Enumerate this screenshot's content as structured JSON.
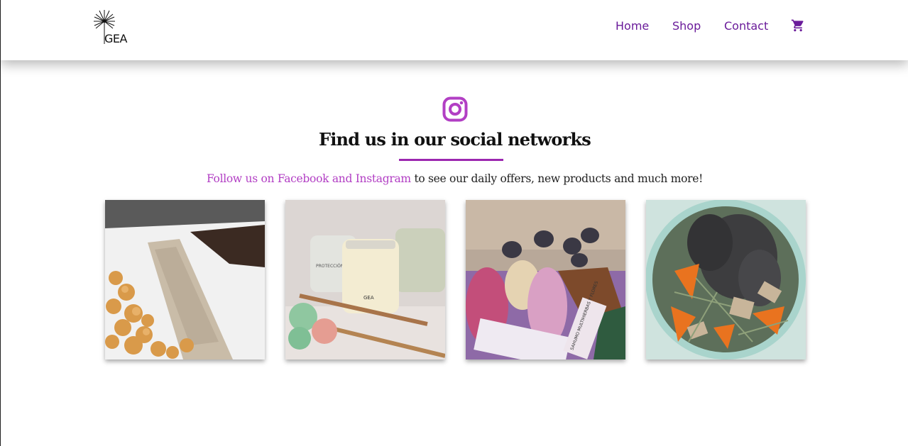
{
  "brand": {
    "logo_text": "GEA",
    "logo_icon": "dandelion-icon"
  },
  "nav": {
    "home": "Home",
    "shop": "Shop",
    "contact": "Contact",
    "cart_icon": "shopping-cart-icon",
    "link_color": "#6a1b9a"
  },
  "section": {
    "icon": "instagram-icon",
    "title": "Find us in our social networks",
    "subtitle_link": "Follow us on Facebook and Instagram",
    "subtitle_rest": " to see our daily offers, new products and much more!",
    "accent_color": "#9c27b0"
  },
  "gallery": {
    "photo4_label": "SAHUMO MULTIHIERBAS Y FLORES",
    "photo2_jar_label": "PROTECCIÓN",
    "photo2_candle_label": "GEA"
  }
}
